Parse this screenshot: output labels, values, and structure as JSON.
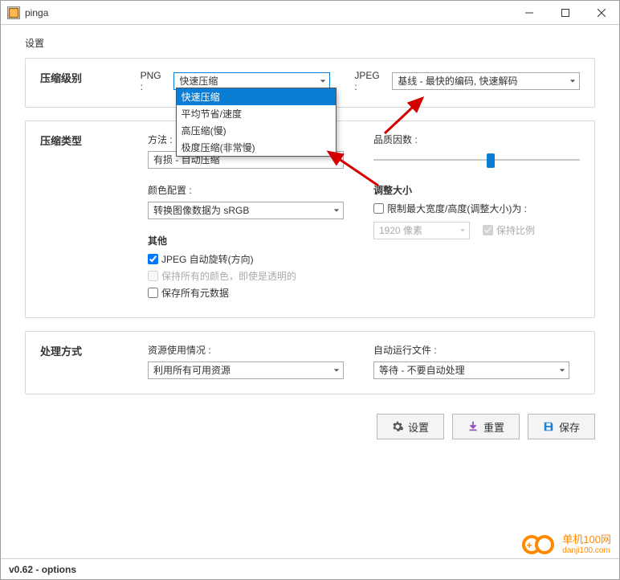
{
  "window": {
    "title": "pinga",
    "page_label": "设置",
    "status": "v0.62 - options"
  },
  "compression_level": {
    "heading": "压缩级别",
    "png_label": "PNG :",
    "png_value": "快速压缩",
    "png_options": [
      "快速压缩",
      "平均节省/速度",
      "高压缩(慢)",
      "极度压缩(非常慢)"
    ],
    "jpeg_label": "JPEG :",
    "jpeg_value": "基线 - 最快的编码, 快速解码"
  },
  "compression_type": {
    "heading": "压缩类型",
    "method_label": "方法 :",
    "method_value": "有损 - 自动压缩",
    "quality_label": "品质因数 :",
    "color_label": "颜色配置 :",
    "color_value": "转换图像数据为 sRGB",
    "resize_label": "调整大小",
    "resize_checkbox": "限制最大宽度/高度(调整大小)为 :",
    "resize_value": "1920 像素",
    "keep_ratio": "保持比例",
    "other_label": "其他",
    "jpeg_autorotate": "JPEG 自动旋转(方向)",
    "keep_colors": "保持所有的颜色，即使是透明的",
    "keep_metadata": "保存所有元数据"
  },
  "processing": {
    "heading": "处理方式",
    "resource_label": "资源使用情况 :",
    "resource_value": "利用所有可用资源",
    "autorun_label": "自动运行文件 :",
    "autorun_value": "等待 - 不要自动处理"
  },
  "buttons": {
    "settings": "设置",
    "reset": "重置",
    "save": "保存"
  },
  "logo": {
    "line1": "单机100网",
    "line2": "danji100.com"
  }
}
